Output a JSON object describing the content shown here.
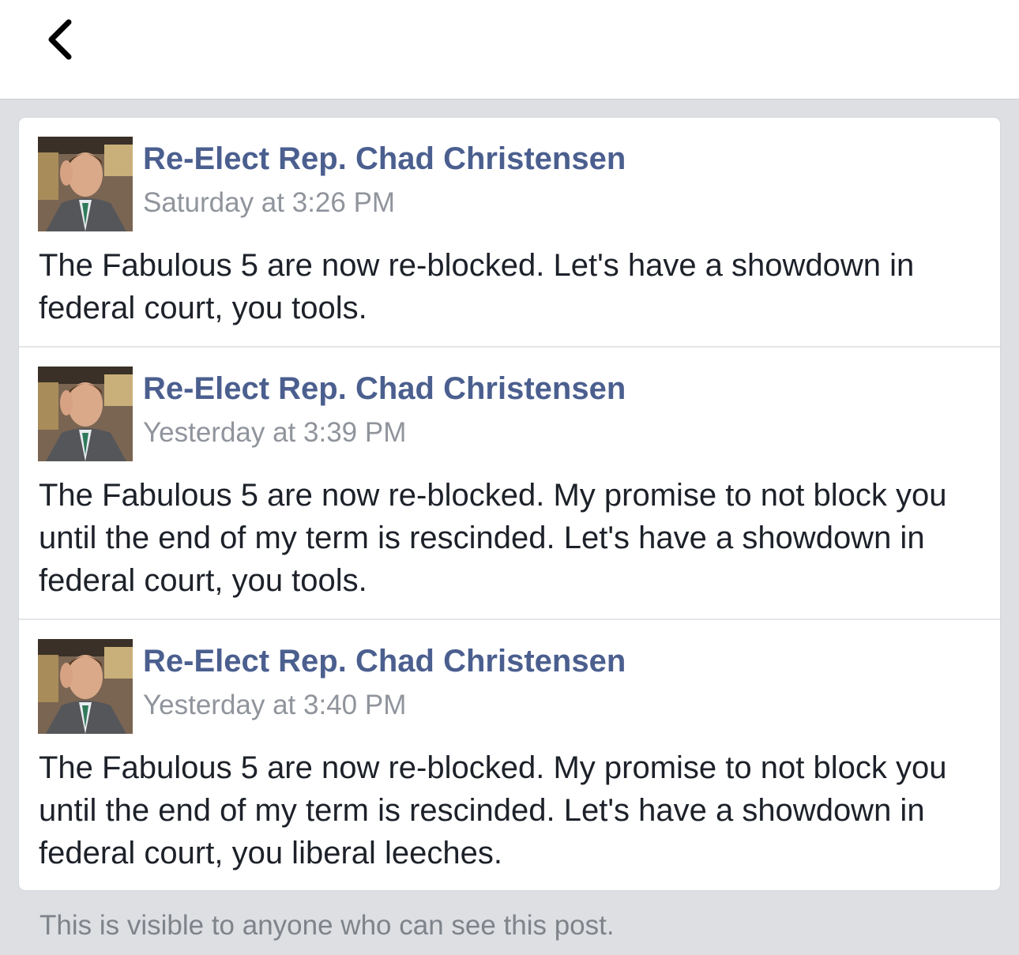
{
  "nav": {
    "back_icon": "chevron-left-icon"
  },
  "posts": [
    {
      "author": "Re-Elect Rep. Chad Christensen",
      "timestamp": "Saturday at 3:26 PM",
      "text": "The Fabulous 5 are now re-blocked. Let's have a showdown in federal court, you tools."
    },
    {
      "author": "Re-Elect Rep. Chad Christensen",
      "timestamp": "Yesterday at 3:39 PM",
      "text": "The Fabulous 5 are now re-blocked. My promise to not block you until the end of my term is rescinded. Let's have a showdown in federal court, you tools."
    },
    {
      "author": "Re-Elect Rep. Chad Christensen",
      "timestamp": "Yesterday at 3:40 PM",
      "text": "The Fabulous 5 are now re-blocked. My promise to not block you until the end of my term is rescinded. Let's have a showdown in federal court, you liberal leeches."
    }
  ],
  "footer": {
    "note": "This is visible to anyone who can see this post."
  },
  "colors": {
    "author": "#4b5f8f",
    "timestamp": "#90949c",
    "body_text": "#1d2129",
    "background": "#dddfe3"
  }
}
